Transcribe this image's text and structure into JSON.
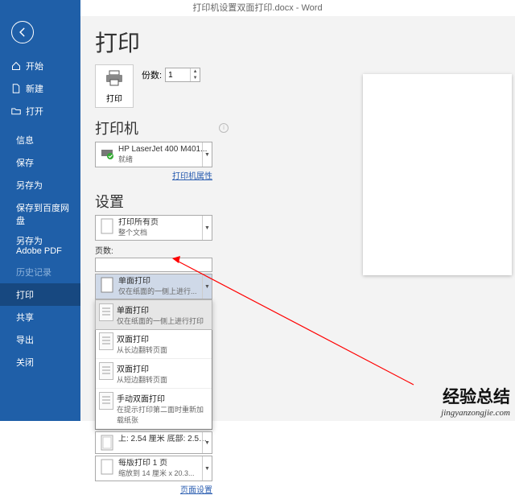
{
  "titlebar": "打印机设置双面打印.docx  -  Word",
  "sidebar": {
    "home": "开始",
    "new": "新建",
    "open": "打开",
    "info": "信息",
    "save": "保存",
    "saveas": "另存为",
    "savecloud": "保存到百度网盘",
    "savepdf": "另存为 Adobe PDF",
    "history": "历史记录",
    "print": "打印",
    "share": "共享",
    "export": "导出",
    "close": "关闭"
  },
  "main": {
    "title": "打印",
    "print_btn": "打印",
    "copies_label": "份数:",
    "copies_value": "1",
    "printer_hdr": "打印机",
    "printer_name": "HP LaserJet 400 M401...",
    "printer_status": "就绪",
    "printer_props": "打印机属性",
    "settings_hdr": "设置",
    "scope_main": "打印所有页",
    "scope_sub": "整个文档",
    "pages_label": "页数:",
    "duplex_selected_main": "单面打印",
    "duplex_selected_sub": "仅在纸面的一侧上进行...",
    "options": [
      {
        "main": "单面打印",
        "sub": "仅在纸面的一侧上进行打印"
      },
      {
        "main": "双面打印",
        "sub": "从长边翻转页面"
      },
      {
        "main": "双面打印",
        "sub": "从短边翻转页面"
      },
      {
        "main": "手动双面打印",
        "sub": "在提示打印第二面时重新加载纸张"
      }
    ],
    "margins_main": "上: 2.54 厘米 底部: 2.54...",
    "sheets_main": "每版打印 1 页",
    "sheets_sub": "缩放到 14 厘米 x 20.3...",
    "page_setup": "页面设置"
  },
  "watermark": {
    "cn": "经验总结",
    "en": "jingyanzongjie.com"
  }
}
